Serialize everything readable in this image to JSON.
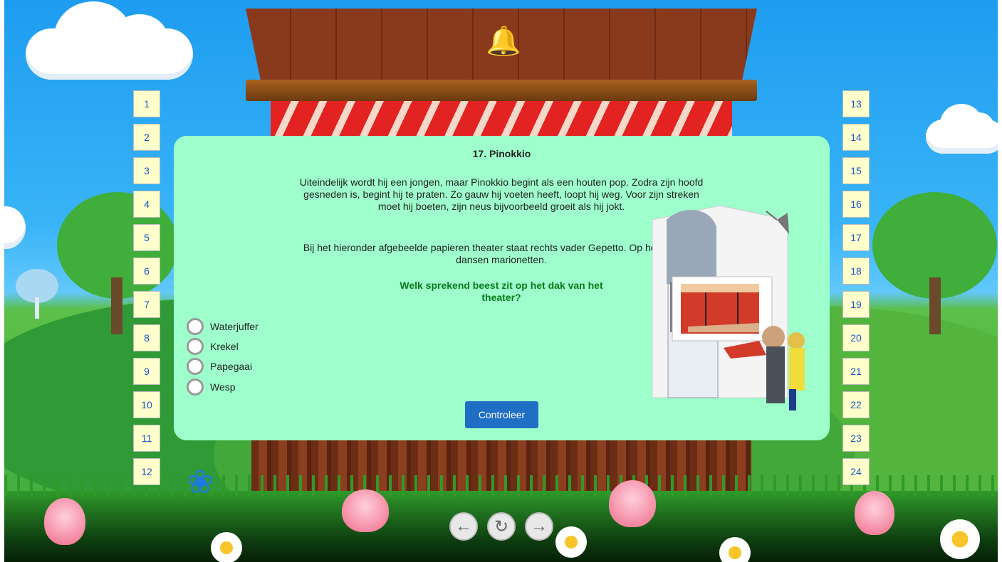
{
  "question": {
    "title": "17. Pinokkio",
    "paragraph1": "Uiteindelijk wordt hij een jongen, maar Pinokkio begint als een houten pop. Zodra zijn hoofd gesneden is, begint hij te praten. Zo gauw hij voeten heeft, loopt hij weg. Voor zijn streken moet hij boeten, zijn neus bijvoorbeeld groeit als hij jokt.",
    "paragraph2": "Bij het hieronder afgebeelde papieren theater staat rechts vader Gepetto. Op het toneeltje dansen marionetten.",
    "prompt": "Welk sprekend beest zit op het dak van het theater?",
    "options": [
      "Waterjuffer",
      "Krekel",
      "Papegaai",
      "Wesp"
    ],
    "check_button": "Controleer"
  },
  "question_numbers_left": [
    "1",
    "2",
    "3",
    "4",
    "5",
    "6",
    "7",
    "8",
    "9",
    "10",
    "11",
    "12"
  ],
  "question_numbers_right": [
    "13",
    "14",
    "15",
    "16",
    "17",
    "18",
    "19",
    "20",
    "21",
    "22",
    "23",
    "24"
  ],
  "navigation": {
    "prev_icon": "arrow-left-icon",
    "reset_icon": "reset-icon",
    "next_icon": "arrow-right-icon"
  },
  "colors": {
    "panel": "#9effcc",
    "prompt_text": "#0b7a1c",
    "button": "#1f6fc4",
    "number_box": "#ffffcc",
    "number_text": "#1a56c4"
  }
}
